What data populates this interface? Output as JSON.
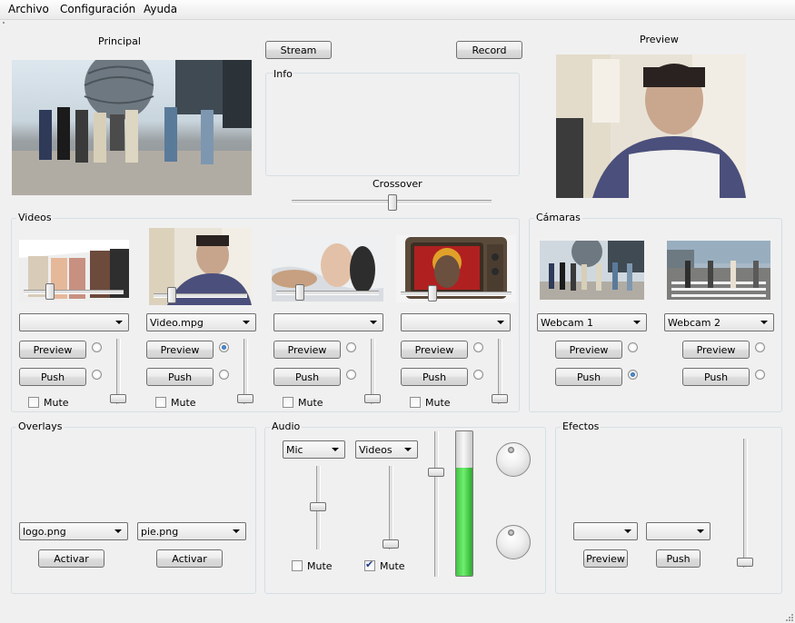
{
  "menu": {
    "archivo": "Archivo",
    "configuracion": "Configuración",
    "ayuda": "Ayuda"
  },
  "principal": {
    "label": "Principal"
  },
  "preview": {
    "label": "Preview"
  },
  "top_buttons": {
    "stream": "Stream",
    "record": "Record"
  },
  "info": {
    "title": "Info"
  },
  "crossover": {
    "label": "Crossover",
    "value": 0.5
  },
  "videos": {
    "title": "Videos",
    "slots": [
      {
        "file": "",
        "preview": "Preview",
        "push": "Push",
        "mute": "Mute",
        "preview_selected": false,
        "push_selected": false,
        "muted": false,
        "volume": 0.0
      },
      {
        "file": "Video.mpg",
        "preview": "Preview",
        "push": "Push",
        "mute": "Mute",
        "preview_selected": true,
        "push_selected": false,
        "muted": false,
        "volume": 0.0
      },
      {
        "file": "",
        "preview": "Preview",
        "push": "Push",
        "mute": "Mute",
        "preview_selected": false,
        "push_selected": false,
        "muted": false,
        "volume": 0.0
      },
      {
        "file": "",
        "preview": "Preview",
        "push": "Push",
        "mute": "Mute",
        "preview_selected": false,
        "push_selected": false,
        "muted": false,
        "volume": 0.0
      }
    ]
  },
  "camaras": {
    "title": "Cámaras",
    "slots": [
      {
        "source": "Webcam 1",
        "preview": "Preview",
        "push": "Push",
        "preview_selected": false,
        "push_selected": true
      },
      {
        "source": "Webcam 2",
        "preview": "Preview",
        "push": "Push",
        "preview_selected": false,
        "push_selected": false
      }
    ]
  },
  "overlays": {
    "title": "Overlays",
    "slots": [
      {
        "file": "logo.png",
        "activate": "Activar"
      },
      {
        "file": "pie.png",
        "activate": "Activar"
      }
    ]
  },
  "audio": {
    "title": "Audio",
    "channels": [
      {
        "source": "Mic",
        "mute": "Mute",
        "muted": false,
        "level": 0.5
      },
      {
        "source": "Videos",
        "mute": "Mute",
        "muted": true,
        "level": 0.05
      }
    ],
    "master_level": 0.77,
    "vu_level": 0.78
  },
  "efectos": {
    "title": "Efectos",
    "preview": "Preview",
    "push": "Push",
    "first": "",
    "second": ""
  },
  "colors": {
    "vu_green": "#44c044",
    "border": "#707070",
    "background": "#f0f0f0"
  }
}
